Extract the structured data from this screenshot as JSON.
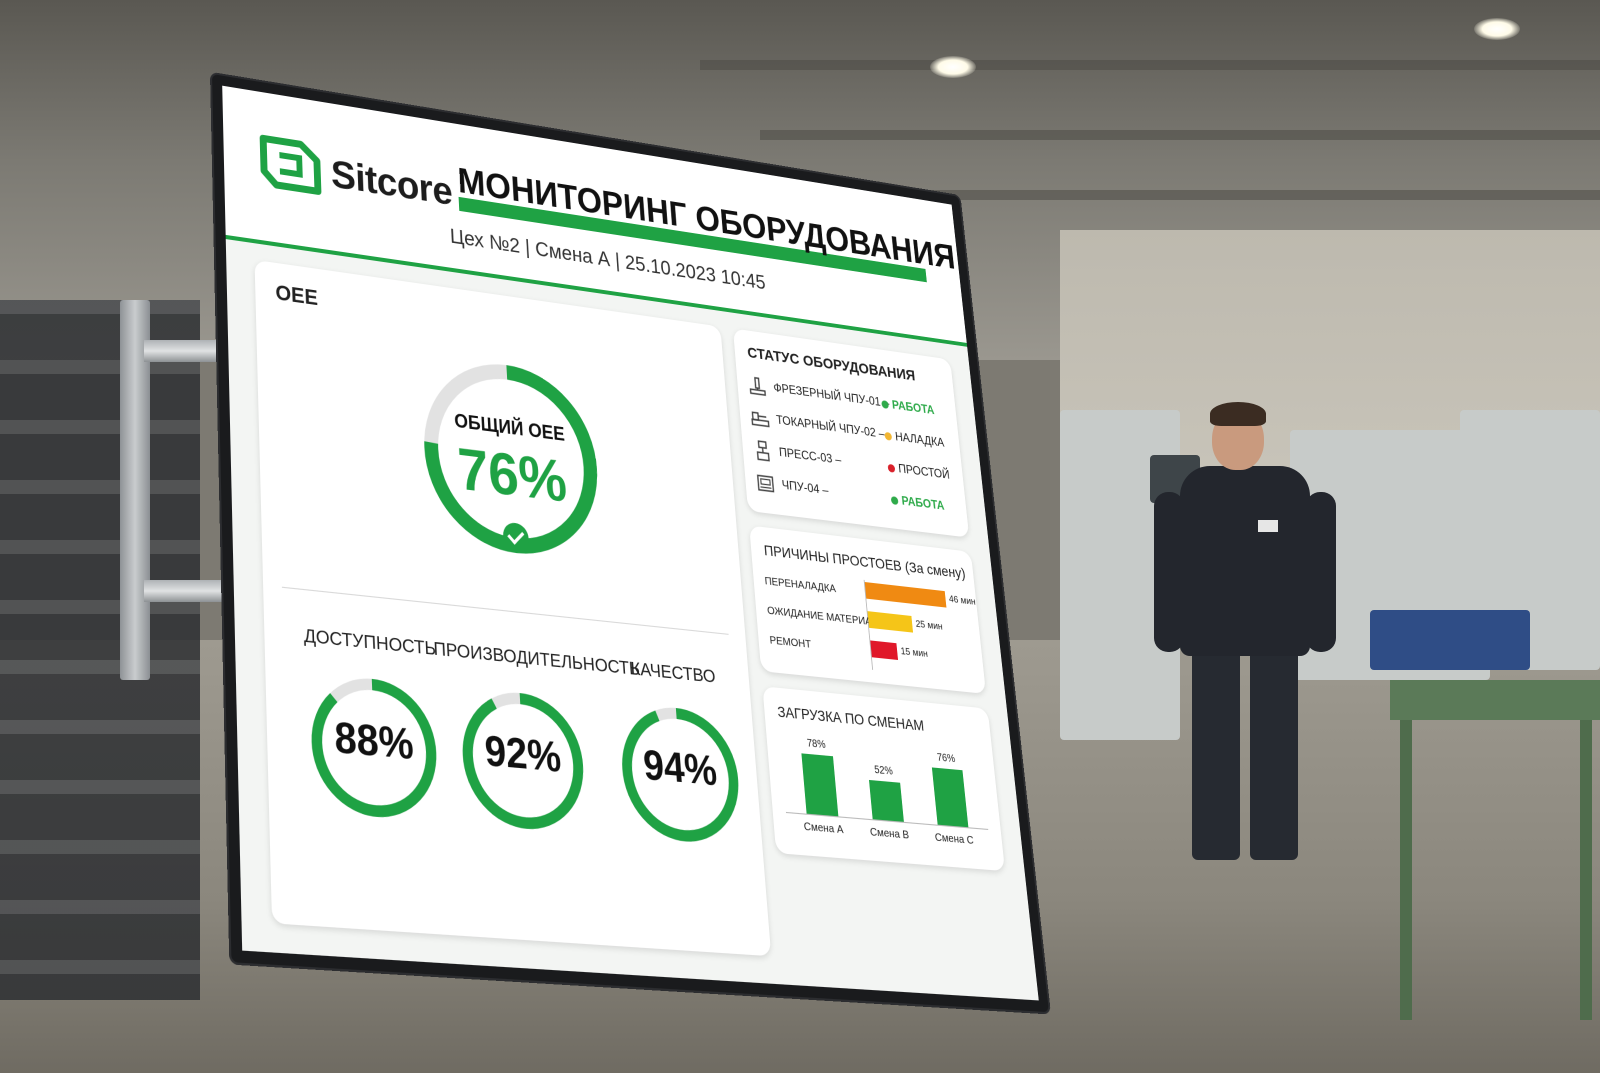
{
  "brand": {
    "name": "Sitcore"
  },
  "header": {
    "title": "МОНИТОРИНГ ОБОРУДОВАНИЯ",
    "subtitle": "Цех №2 | Смена А | 25.10.2023 10:45"
  },
  "oee": {
    "label": "OEE",
    "overall_caption": "ОБЩИЙ OEE",
    "overall_value": "76%",
    "overall_percent": 76,
    "metrics": [
      {
        "label": "ДОСТУПНОСТЬ",
        "value": "88%",
        "percent": 88
      },
      {
        "label": "ПРОИЗВОДИТЕЛЬНОСТЬ",
        "value": "92%",
        "percent": 92
      },
      {
        "label": "КАЧЕСТВО",
        "value": "94%",
        "percent": 94
      }
    ]
  },
  "equipment_status": {
    "title": "СТАТУС ОБОРУДОВАНИЯ",
    "items": [
      {
        "name": "ФРЕЗЕРНЫЙ ЧПУ-01 –",
        "status": "РАБОТА",
        "color": "#2eaa4a",
        "icon": "milling-machine-icon"
      },
      {
        "name": "ТОКАРНЫЙ ЧПУ-02 –",
        "status": "НАЛАДКА",
        "color": "#f2b632",
        "icon": "lathe-icon"
      },
      {
        "name": "ПРЕСС-03 –",
        "status": "ПРОСТОЙ",
        "color": "#d9202a",
        "icon": "press-icon"
      },
      {
        "name": "ЧПУ-04 –",
        "status": "РАБОТА",
        "color": "#2eaa4a",
        "icon": "cnc-machine-icon"
      }
    ]
  },
  "downtime": {
    "title": "ПРИЧИНЫ ПРОСТОЕВ (За смену)",
    "unit": "мин",
    "items": [
      {
        "label": "ПЕРЕНАЛАДКА",
        "value": 46,
        "value_label": "46 мин",
        "color": "#f08a12"
      },
      {
        "label": "ОЖИДАНИЕ МАТЕРИАЙЬ",
        "value": 25,
        "value_label": "25 мин",
        "color": "#f5c518"
      },
      {
        "label": "РЕМОНТ",
        "value": 15,
        "value_label": "15 мин",
        "color": "#e0182a"
      }
    ]
  },
  "shift_load": {
    "title": "ЗАГРУЗКА ПО СМЕНАМ",
    "categories": [
      "Смена А",
      "Смена В",
      "Смена С"
    ],
    "values": [
      78,
      52,
      76
    ],
    "value_labels": [
      "78%",
      "52%",
      "76%"
    ]
  },
  "colors": {
    "accent": "#1fa244",
    "ring_track": "#e2e2e2"
  },
  "chart_data": [
    {
      "type": "bar",
      "title": "ПРИЧИНЫ ПРОСТОЕВ (За смену)",
      "orientation": "horizontal",
      "categories": [
        "ПЕРЕНАЛАДКА",
        "ОЖИДАНИЕ МАТЕРИАЙЬ",
        "РЕМОНТ"
      ],
      "values": [
        46,
        25,
        15
      ],
      "unit": "мин"
    },
    {
      "type": "bar",
      "title": "ЗАГРУЗКА ПО СМЕНАМ",
      "categories": [
        "Смена А",
        "Смена В",
        "Смена С"
      ],
      "values": [
        78,
        52,
        76
      ],
      "unit": "%"
    }
  ]
}
